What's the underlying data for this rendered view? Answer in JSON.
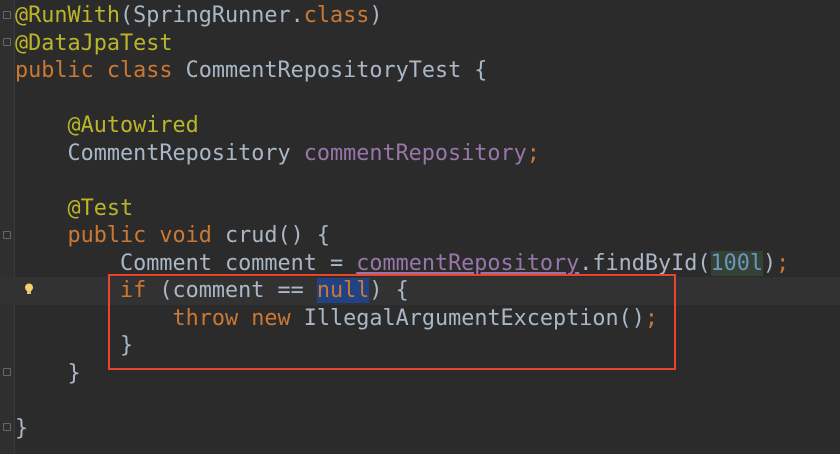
{
  "editor": {
    "current_line_index": 10,
    "lines": [
      [
        {
          "t": "@RunWith",
          "c": "ann"
        },
        {
          "t": "(SpringRunner.",
          "c": "plain"
        },
        {
          "t": "class",
          "c": "kw"
        },
        {
          "t": ")",
          "c": "plain"
        }
      ],
      [
        {
          "t": "@DataJpaTest",
          "c": "ann"
        }
      ],
      [
        {
          "t": "public class ",
          "c": "kw"
        },
        {
          "t": "CommentRepositoryTest {",
          "c": "plain"
        }
      ],
      [],
      [
        {
          "t": "    "
        },
        {
          "t": "@Autowired",
          "c": "ann"
        }
      ],
      [
        {
          "t": "    CommentRepository ",
          "c": "plain"
        },
        {
          "t": "commentRepository",
          "c": "field"
        },
        {
          "t": ";",
          "c": "kw"
        }
      ],
      [],
      [
        {
          "t": "    "
        },
        {
          "t": "@Test",
          "c": "ann"
        }
      ],
      [
        {
          "t": "    "
        },
        {
          "t": "public void ",
          "c": "kw"
        },
        {
          "t": "crud() {",
          "c": "plain"
        }
      ],
      [
        {
          "t": "        Comment comment = ",
          "c": "plain"
        },
        {
          "t": "commentRepository",
          "c": "field u"
        },
        {
          "t": ".findById(",
          "c": "plain"
        },
        {
          "t": "100l",
          "c": "num"
        },
        {
          "t": ")",
          "c": "plain"
        },
        {
          "t": ";",
          "c": "kw"
        }
      ],
      [
        {
          "t": "        "
        },
        {
          "t": "if ",
          "c": "kw"
        },
        {
          "t": "(comment == ",
          "c": "plain"
        },
        {
          "t": "null",
          "c": "kw nullsel"
        },
        {
          "t": ") {",
          "c": "plain"
        }
      ],
      [
        {
          "t": "            "
        },
        {
          "t": "throw new ",
          "c": "kw"
        },
        {
          "t": "IllegalArgumentException()",
          "c": "plain"
        },
        {
          "t": ";",
          "c": "kw"
        }
      ],
      [
        {
          "t": "        }",
          "c": "plain"
        }
      ],
      [
        {
          "t": "    }",
          "c": "plain"
        }
      ],
      [],
      [
        {
          "t": "}",
          "c": "plain"
        }
      ]
    ]
  },
  "colors": {
    "annotation": "#bbb529",
    "keyword": "#cc7832",
    "field": "#9876aa",
    "number": "#6897bb",
    "text": "#a9b7c6",
    "background": "#2b2b2b",
    "highlight_box": "#e8452c"
  }
}
